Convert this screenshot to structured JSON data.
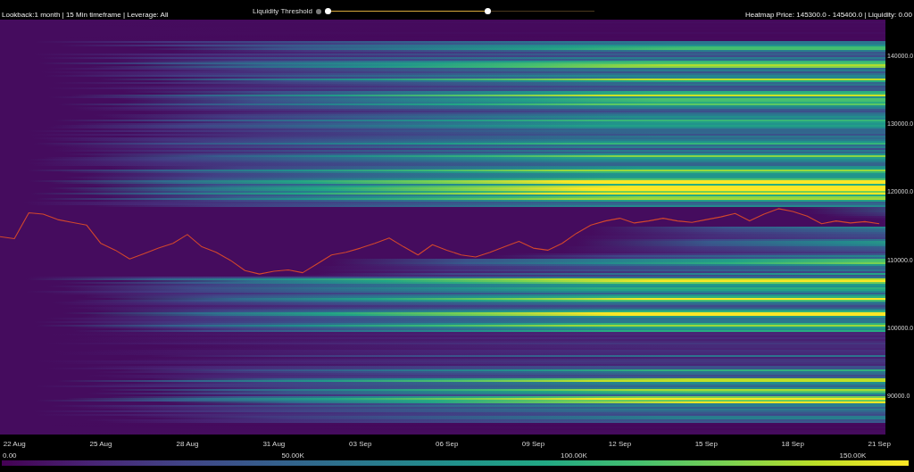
{
  "header": {
    "settings": "Lookback:1 month | 15 Min timeframe | Leverage: All",
    "readout": "Heatmap Price: 145300.0 - 145400.0 | Liquidity: 0.00"
  },
  "liquidity_threshold": {
    "label": "Liquidity Threshold",
    "thumbs": [
      {
        "level": 0
      },
      {
        "level": 0.6
      }
    ]
  },
  "heatmap": {
    "chart_data": {
      "type": "line",
      "categories": [
        null,
        "22 Aug",
        null,
        null,
        null,
        null,
        null,
        "25 Aug",
        null,
        null,
        null,
        null,
        null,
        "28 Aug",
        null,
        null,
        null,
        null,
        null,
        "31 Aug",
        null,
        null,
        null,
        null,
        null,
        "03 Sep",
        null,
        null,
        null,
        null,
        null,
        "06 Sep",
        null,
        null,
        null,
        null,
        null,
        "09 Sep",
        null,
        null,
        null,
        null,
        null,
        "12 Sep",
        null,
        null,
        null,
        null,
        null,
        "15 Sep",
        null,
        null,
        null,
        null,
        null,
        "18 Sep",
        null,
        null,
        null,
        null,
        null,
        "21 Sep"
      ],
      "series": [
        {
          "color": "#d2472c",
          "values": [
            113500,
            113200,
            117000,
            116800,
            116000,
            115600,
            115200,
            112500,
            111500,
            110200,
            111000,
            111800,
            112500,
            113800,
            112000,
            111200,
            110000,
            108500,
            108000,
            108400,
            108600,
            108200,
            109500,
            110800,
            111200,
            111800,
            112500,
            113300,
            112000,
            110800,
            112300,
            111500,
            110800,
            110500,
            111200,
            112000,
            112800,
            111800,
            111500,
            112500,
            114000,
            115200,
            115800,
            116200,
            115500,
            115800,
            116200,
            115800,
            115600,
            116000,
            116400,
            116900,
            115800,
            116800,
            117600,
            117200,
            116500,
            115400,
            115800,
            115500,
            115700,
            115400
          ]
        }
      ],
      "ylim": [
        84400,
        145400
      ],
      "yticks": [
        {
          "value": 90000,
          "label": "90000.0"
        },
        {
          "value": 100000,
          "label": "100000.0"
        },
        {
          "value": 110000,
          "label": "110000.0"
        },
        {
          "value": 120000,
          "label": "120000.0"
        },
        {
          "value": 130000,
          "label": "130000.0"
        },
        {
          "value": 140000,
          "label": "140000.0"
        }
      ]
    }
  },
  "color_scale": {
    "labels": [
      "0.00",
      "50.00K",
      "100.00K",
      "150.00K"
    ]
  }
}
